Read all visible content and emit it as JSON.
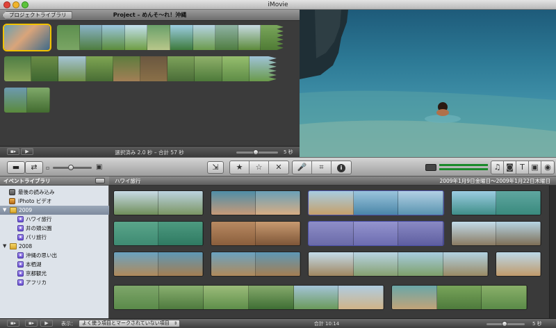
{
  "window": {
    "title": "iMovie"
  },
  "project": {
    "back_label": "プロジェクトライブラリ",
    "title": "Project – めんそ～れ！沖縄",
    "status": "選択済み 2.0 秒 – 合計 57 秒",
    "duration_label": "5 秒"
  },
  "toolbar": {
    "icons": [
      "camera-icon",
      "swap-icon",
      "crop-icon",
      "star-icon",
      "star-outline-icon",
      "reject-icon",
      "microphone-icon",
      "info-icon",
      "music-icon",
      "photo-icon",
      "title-icon",
      "transition-icon",
      "map-icon"
    ],
    "labels": {
      "voiceover": "🎤",
      "crop": "⌗",
      "info": "i",
      "music": "♫",
      "photo": "◙",
      "title": "T",
      "transition": "▣",
      "map": "◉",
      "favorite": "★",
      "unmark": "☆",
      "reject": "✕"
    }
  },
  "event_library": {
    "header": "イベントライブラリ",
    "items": [
      {
        "label": "最後の読み込み",
        "indent": 1
      },
      {
        "label": "iPhoto ビデオ",
        "indent": 1
      },
      {
        "label": "2009",
        "indent": 0,
        "year": true,
        "selected": true
      },
      {
        "label": "ハワイ旅行",
        "indent": 2
      },
      {
        "label": "井の頭公園",
        "indent": 2
      },
      {
        "label": "パリ旅行",
        "indent": 2
      },
      {
        "label": "2008",
        "indent": 0,
        "year": true
      },
      {
        "label": "沖縄の思い出",
        "indent": 2
      },
      {
        "label": "本栖湖",
        "indent": 2
      },
      {
        "label": "京都観光",
        "indent": 2
      },
      {
        "label": "アフリカ",
        "indent": 2
      }
    ]
  },
  "event_browser": {
    "event_name": "ハワイ旅行",
    "date_range": "2009年1月9日金曜日〜2009年1月22日木曜日"
  },
  "bottom": {
    "show_label": "表示：",
    "filter_value": "よく使う項目とマークされていない項目",
    "total": "合計 10:14",
    "duration_label": "5 秒"
  },
  "colors": {
    "selection": "#f2c200",
    "event_icon": "#7a5fe0",
    "year_icon": "#e8bd45"
  }
}
